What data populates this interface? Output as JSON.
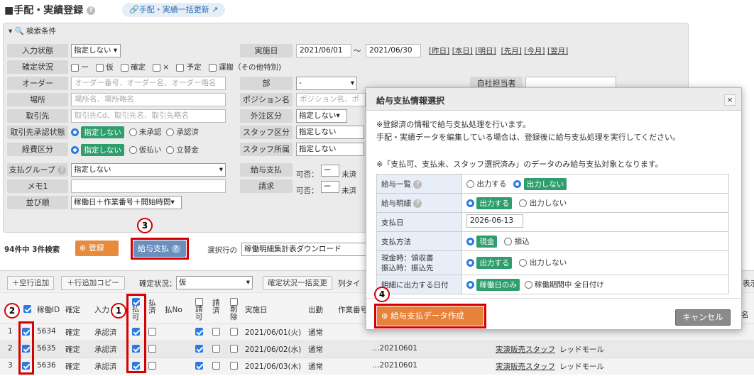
{
  "page": {
    "title": "手配・実績登録",
    "bulk_update": "手配・実績一括更新"
  },
  "search": {
    "header": "検索条件",
    "input_status": {
      "label": "入力状態",
      "value": "指定しない"
    },
    "execution_date": {
      "label": "実施日",
      "from": "2021/06/01",
      "sep": "〜",
      "to": "2021/06/30"
    },
    "date_links": [
      "[昨日]",
      "[本日]",
      "[明日]",
      "[先月]",
      "[今月]",
      "[翌月]"
    ],
    "confirm_status": {
      "label": "確定状況",
      "options": [
        "ー",
        "仮",
        "確定",
        "×",
        "予定",
        "運搬（その他特別)"
      ]
    },
    "order": {
      "label": "オーダー",
      "placeholder": "オーダー番号、オーダー名、オーダー略名"
    },
    "department": {
      "label": "部",
      "value": "-"
    },
    "own_staff": {
      "label": "自社担当者"
    },
    "site": {
      "label": "場所",
      "placeholder": "場所名、場所略名"
    },
    "position": {
      "label": "ポジション名",
      "placeholder": "ポジション名、ポ"
    },
    "client": {
      "label": "取引先",
      "placeholder": "取引先Cd、取引先名、取引先略名"
    },
    "out_category": {
      "label": "外注区分",
      "value": "指定しない"
    },
    "client_approval": {
      "label": "取引先承認状態",
      "options": [
        "指定しない",
        "未承認",
        "承認済"
      ]
    },
    "staff_category": {
      "label": "スタッフ区分",
      "value": "指定しない"
    },
    "expense": {
      "label": "経費区分",
      "options": [
        "指定しない",
        "仮払い",
        "立替金"
      ]
    },
    "staff_affiliation": {
      "label": "スタッフ所属",
      "value": "指定しない"
    },
    "payment_group": {
      "label": "支払グループ",
      "value": "指定しない"
    },
    "salary_payment": {
      "label": "給与支払",
      "text": "可否：",
      "value": "ー",
      "suffix": "未済"
    },
    "memo": {
      "label": "メモ1"
    },
    "billing": {
      "label": "請求",
      "text": "可否：",
      "value": "ー",
      "suffix": "未済"
    },
    "sort": {
      "label": "並び順",
      "value": "稼働日＋作業番号＋開始時間"
    }
  },
  "toolbar": {
    "count": "94件中",
    "count_b": "3件検索",
    "register": "登録",
    "pay_salary": "給与支払",
    "selected_row": "選択行の",
    "report": "稼働明細集計表ダウンロード"
  },
  "grid_toolbar": {
    "add_empty": "空行追加",
    "add_copy": "行追加コピー",
    "confirm_label": "確定状況：",
    "confirm_value": "仮",
    "bulk_change": "確定状況一括変更",
    "list": "列タイ",
    "display": "表示"
  },
  "columns": {
    "id": "稼働ID",
    "confirm": "確定",
    "input": "入力",
    "pay": "払可",
    "paid": "払済",
    "payno": "払No",
    "bill": "請可",
    "billed": "請済",
    "del": "削除",
    "date": "実施日",
    "attend": "出勤",
    "workno": "作業番号",
    "name": "名"
  },
  "rows": [
    {
      "n": "1",
      "id": "5634",
      "confirm": "確定",
      "input": "承認済",
      "date": "2021/06/01(火)",
      "attend": "通常"
    },
    {
      "n": "2",
      "id": "5635",
      "confirm": "確定",
      "input": "承認済",
      "date": "2021/06/02(水)",
      "attend": "通常",
      "workno": "20210601",
      "staff": "実演販売スタッフ",
      "place": "レッドモール"
    },
    {
      "n": "3",
      "id": "5636",
      "confirm": "確定",
      "input": "承認済",
      "date": "2021/06/03(木)",
      "attend": "通常",
      "workno": "20210601",
      "staff": "実演販売スタッフ",
      "place": "レッドモール"
    }
  ],
  "dialog": {
    "title": "給与支払情報選択",
    "close": "×",
    "msg1": "※登録済の情報で給与支払処理を行います。",
    "msg2": "手配・実績データを編集している場合は、登録後に給与支払処理を実行してください。",
    "msg3": "※「支払可、支払未、スタッフ選択済み」のデータのみ給与支払対象となります。",
    "rows": {
      "list": "給与一覧",
      "detail": "給与明細",
      "pay_date": "支払日",
      "method": "支払方法",
      "cash1": "現金時：領収書",
      "cash2": "振込時：振込先",
      "date_in": "明細に出力する日付"
    },
    "out": "出力する",
    "noout": "出力しない",
    "pay_date_value": "2026-06-13",
    "cash": "現金",
    "transfer": "振込",
    "work_day_only": "稼働日のみ",
    "period_all": "稼働期間中 全日付け",
    "create": "給与支払データ作成",
    "cancel": "キャンセル"
  },
  "markers": [
    "1",
    "2",
    "3",
    "4"
  ]
}
